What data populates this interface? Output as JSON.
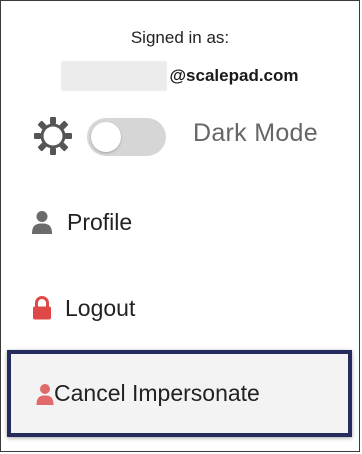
{
  "account": {
    "signed_in_label": "Signed in as:",
    "email_domain": "@scalepad.com"
  },
  "theme": {
    "dark_mode_label": "Dark Mode",
    "dark_mode_on": false,
    "sun_icon": "sun-icon"
  },
  "menu": {
    "profile": {
      "label": "Profile",
      "icon": "user-icon",
      "icon_color": "#6b6b6b"
    },
    "logout": {
      "label": "Logout",
      "icon": "lock-icon",
      "icon_color": "#e04848"
    },
    "cancel_impersonate": {
      "label": "Cancel Impersonate",
      "icon": "user-icon",
      "icon_color": "#e06a6a",
      "highlight_border": "#262b5e"
    }
  }
}
